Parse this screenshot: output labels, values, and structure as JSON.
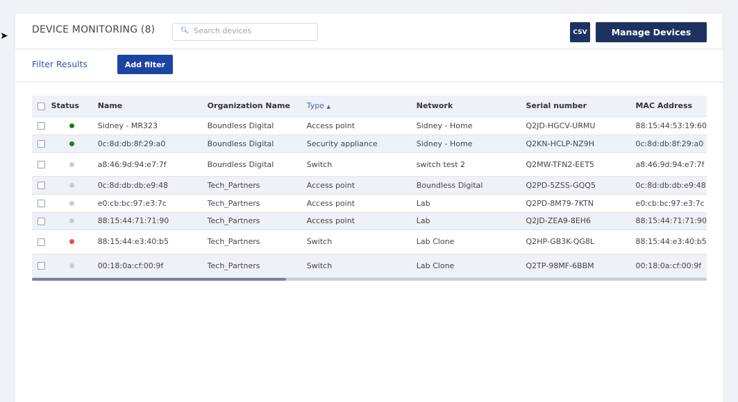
{
  "header": {
    "title": "DEVICE MONITORING (8)",
    "search_placeholder": "Search devices",
    "csv_label": "CSV",
    "manage_label": "Manage Devices"
  },
  "filters": {
    "label": "Filter Results",
    "add_label": "Add filter"
  },
  "table": {
    "columns": [
      "Status",
      "Name",
      "Organization Name",
      "Type",
      "Network",
      "Serial number",
      "MAC Address"
    ],
    "sorted_column": "Type",
    "sort_direction": "ascending",
    "status_colors": {
      "online": "#1a7f1a",
      "offline": "#c5cad3",
      "alerting": "#e84b4b"
    },
    "rows": [
      {
        "status": "online",
        "name": "Sidney - MR323",
        "org": "Boundless Digital",
        "type": "Access point",
        "network": "Sidney - Home",
        "serial": "Q2JD-HGCV-URMU",
        "mac": "88:15:44:53:19:60"
      },
      {
        "status": "online",
        "name": "0c:8d:db:8f:29:a0",
        "org": "Boundless Digital",
        "type": "Security appliance",
        "network": "Sidney - Home",
        "serial": "Q2KN-HCLP-NZ9H",
        "mac": "0c:8d:db:8f:29:a0"
      },
      {
        "status": "offline",
        "name": "a8:46:9d:94:e7:7f",
        "org": "Boundless Digital",
        "type": "Switch",
        "network": "switch test 2",
        "serial": "Q2MW-TFN2-EET5",
        "mac": "a8:46:9d:94:e7:7f"
      },
      {
        "status": "offline",
        "name": "0c:8d:db:db:e9:48",
        "org": "Tech_Partners",
        "type": "Access point",
        "network": "Boundless Digital",
        "serial": "Q2PD-5ZSS-GQQ5",
        "mac": "0c:8d:db:db:e9:48"
      },
      {
        "status": "offline",
        "name": "e0:cb:bc:97:e3:7c",
        "org": "Tech_Partners",
        "type": "Access point",
        "network": "Lab",
        "serial": "Q2PD-8M79-7KTN",
        "mac": "e0:cb:bc:97:e3:7c"
      },
      {
        "status": "offline",
        "name": "88:15:44:71:71:90",
        "org": "Tech_Partners",
        "type": "Access point",
        "network": "Lab",
        "serial": "Q2JD-ZEA9-8EH6",
        "mac": "88:15:44:71:71:90"
      },
      {
        "status": "alerting",
        "name": "88:15:44:e3:40:b5",
        "org": "Tech_Partners",
        "type": "Switch",
        "network": "Lab Clone",
        "serial": "Q2HP-GB3K-QG8L",
        "mac": "88:15:44:e3:40:b5"
      },
      {
        "status": "offline",
        "name": "00:18:0a:cf:00:9f",
        "org": "Tech_Partners",
        "type": "Switch",
        "network": "Lab Clone",
        "serial": "Q2TP-98MF-6BBM",
        "mac": "00:18:0a:cf:00:9f"
      }
    ]
  }
}
